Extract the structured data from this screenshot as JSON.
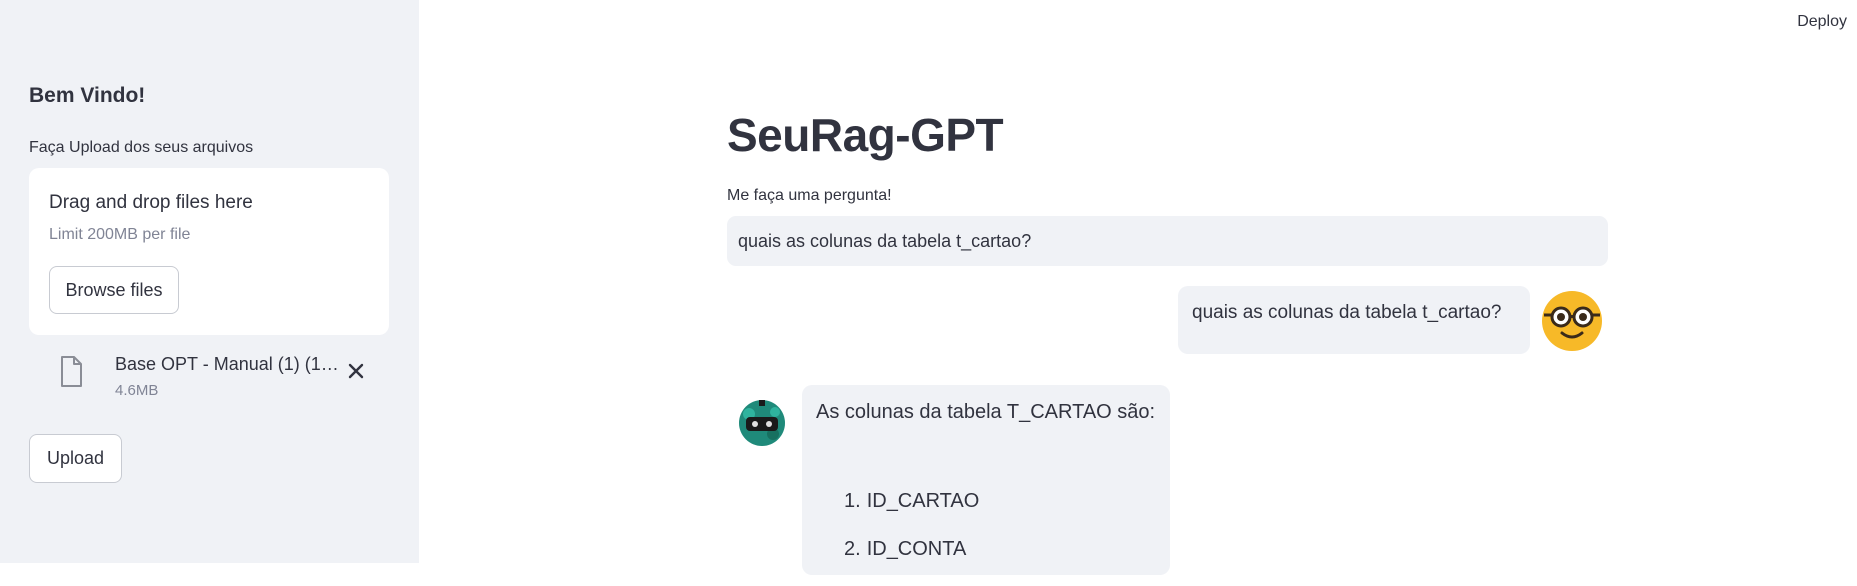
{
  "sidebar": {
    "title": "Bem Vindo!",
    "upload_label": "Faça Upload dos seus arquivos",
    "dropzone": {
      "title": "Drag and drop files here",
      "limit": "Limit 200MB per file",
      "browse_label": "Browse files"
    },
    "file": {
      "name": "Base OPT - Manual (1) (1).pdf",
      "size": "4.6MB",
      "icon": "file-icon",
      "remove_icon": "close-icon"
    },
    "upload_button": "Upload"
  },
  "header": {
    "deploy_label": "Deploy"
  },
  "main": {
    "title": "SeuRag-GPT",
    "input_label": "Me faça uma pergunta!",
    "input_value": "quais as colunas da tabela t_cartao?",
    "messages": [
      {
        "role": "user",
        "avatar": "nerd-face-emoji-avatar",
        "text": "quais as colunas da tabela t_cartao?"
      },
      {
        "role": "assistant",
        "avatar": "robot-avatar",
        "intro": "As colunas da tabela T_CARTAO são:",
        "list": [
          {
            "num": "1.",
            "text": "ID_CARTAO"
          },
          {
            "num": "2.",
            "text": "ID_CONTA"
          }
        ]
      }
    ]
  },
  "colors": {
    "sidebar_bg": "#f0f2f6",
    "text": "#31333f",
    "muted_text": "#808495",
    "message_bg": "#f0f2f6",
    "user_avatar": "#f7b928",
    "bot_avatar": "#1f8a7a"
  }
}
